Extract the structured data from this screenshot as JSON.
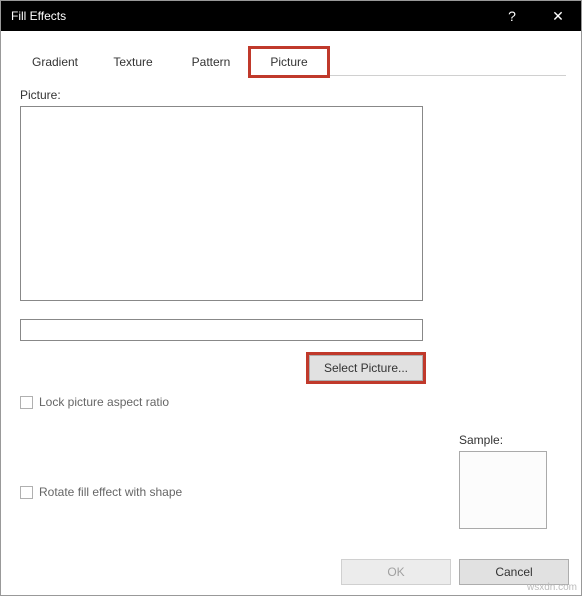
{
  "titlebar": {
    "title": "Fill Effects",
    "help": "?",
    "close": "✕"
  },
  "tabs": {
    "gradient": "Gradient",
    "texture": "Texture",
    "pattern": "Pattern",
    "picture": "Picture"
  },
  "panel": {
    "picture_label": "Picture:",
    "select_picture": "Select Picture...",
    "lock_aspect": "Lock picture aspect ratio",
    "rotate_fill": "Rotate fill effect with shape",
    "sample_label": "Sample:"
  },
  "buttons": {
    "ok": "OK",
    "cancel": "Cancel"
  },
  "watermark": "wsxdn.com"
}
